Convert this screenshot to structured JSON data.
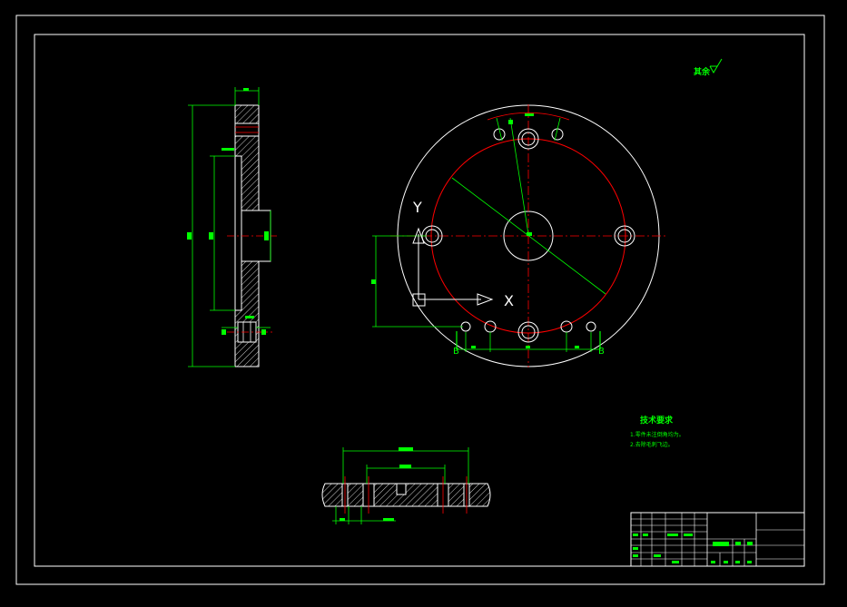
{
  "roughness_note": {
    "text": "其余"
  },
  "tech_requirements": {
    "title": "技术要求",
    "items": [
      "1.零件未注倒角均为。",
      "2.去除毛刺飞边。"
    ]
  },
  "ucs": {
    "x_label": "X",
    "y_label": "Y"
  },
  "section_labels": {
    "left": "B",
    "right": "B"
  },
  "colors": {
    "background": "#000000",
    "outline": "#ffffff",
    "dimension": "#00ff00",
    "centerline": "#ff0000"
  }
}
